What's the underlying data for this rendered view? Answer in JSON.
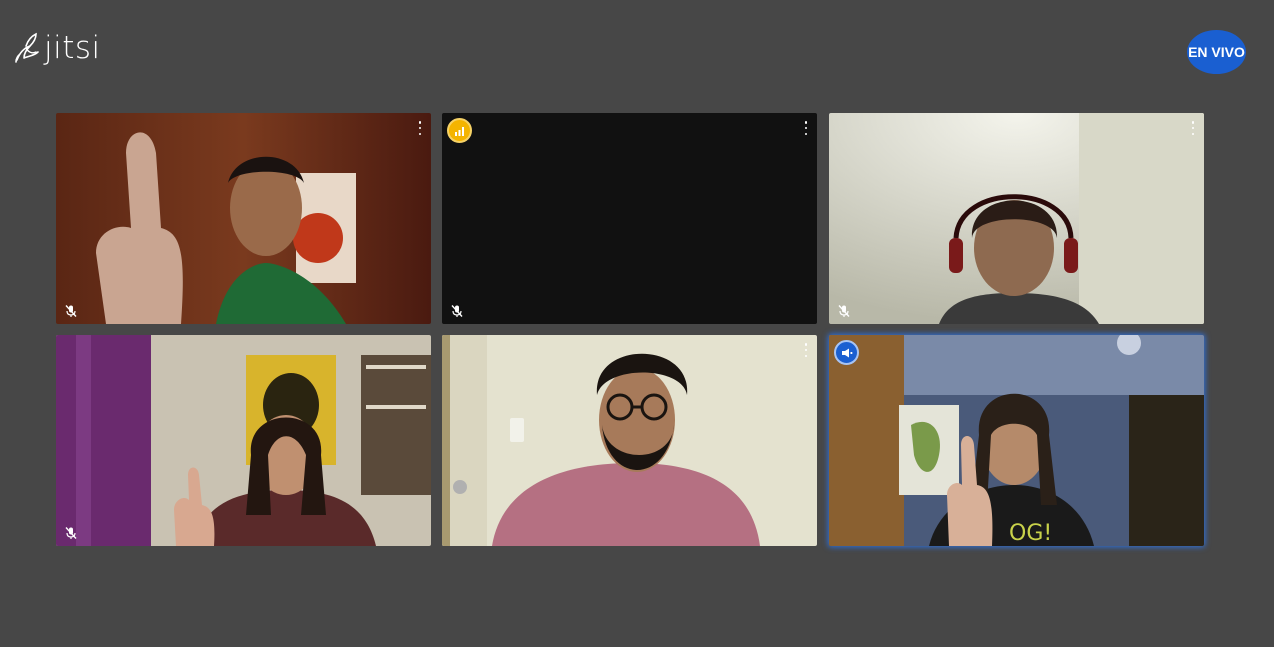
{
  "app": {
    "name": "jitsi",
    "logo_icon": "jitsi-bird-icon"
  },
  "header": {
    "live_label": "EN VIVO",
    "live_color": "#1a5fd1"
  },
  "colors": {
    "background": "#474747",
    "active_border": "#2d72e0",
    "connection_warning": "#f4b400"
  },
  "participants": [
    {
      "id": "p1",
      "muted": true,
      "video": true,
      "menu": true
    },
    {
      "id": "p2",
      "muted": true,
      "video": false,
      "menu": true,
      "connection_indicator": "connection-signal-icon"
    },
    {
      "id": "p3",
      "muted": true,
      "video": true,
      "menu": true
    },
    {
      "id": "p4",
      "muted": true,
      "video": true,
      "menu": false
    },
    {
      "id": "p5",
      "muted": false,
      "video": true,
      "menu": true
    },
    {
      "id": "p6",
      "muted": false,
      "video": true,
      "menu": false,
      "dominant_speaker": true,
      "indicator": "dominant-speaker-icon"
    }
  ]
}
